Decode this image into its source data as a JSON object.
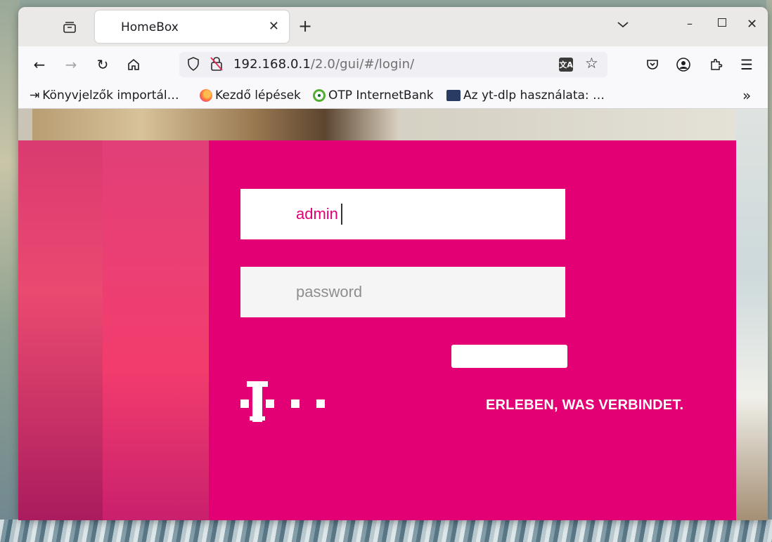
{
  "browser": {
    "tab": {
      "title": "HomeBox"
    },
    "url": {
      "host": "192.168.0.1",
      "path": "/2.0/gui/#/login/"
    },
    "bookmarks": [
      {
        "label": "Könyvjelzők importál…",
        "icon": "import-icon"
      },
      {
        "label": "Kezdő lépések",
        "icon": "firefox-icon"
      },
      {
        "label": "OTP InternetBank",
        "icon": "otp-icon"
      },
      {
        "label": "Az yt-dlp használata: …",
        "icon": "yt-dlp-icon"
      }
    ]
  },
  "login": {
    "username_value": "admin",
    "password_placeholder": "password",
    "slogan": "ERLEBEN, WAS VERBINDET."
  },
  "colors": {
    "brand_magenta": "#e20074"
  }
}
